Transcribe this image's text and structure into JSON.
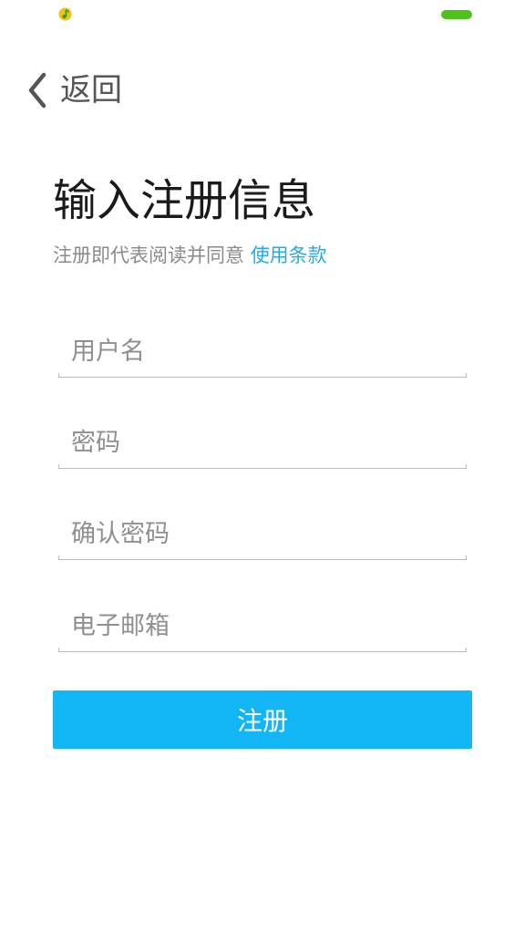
{
  "status_bar": {
    "app_icon": "qq-music-icon",
    "battery_icon": "battery-icon",
    "battery_color": "#4ec21b"
  },
  "nav": {
    "back_icon": "chevron-left-icon",
    "back_label": "返回"
  },
  "page": {
    "title": "输入注册信息",
    "terms_prefix": "注册即代表阅读并同意",
    "terms_link": "使用条款",
    "link_color": "#1faee6"
  },
  "form": {
    "username_placeholder": "用户名",
    "password_placeholder": "密码",
    "confirm_password_placeholder": "确认密码",
    "email_placeholder": "电子邮箱"
  },
  "register_button": {
    "label": "注册",
    "color": "#13b6f5"
  }
}
